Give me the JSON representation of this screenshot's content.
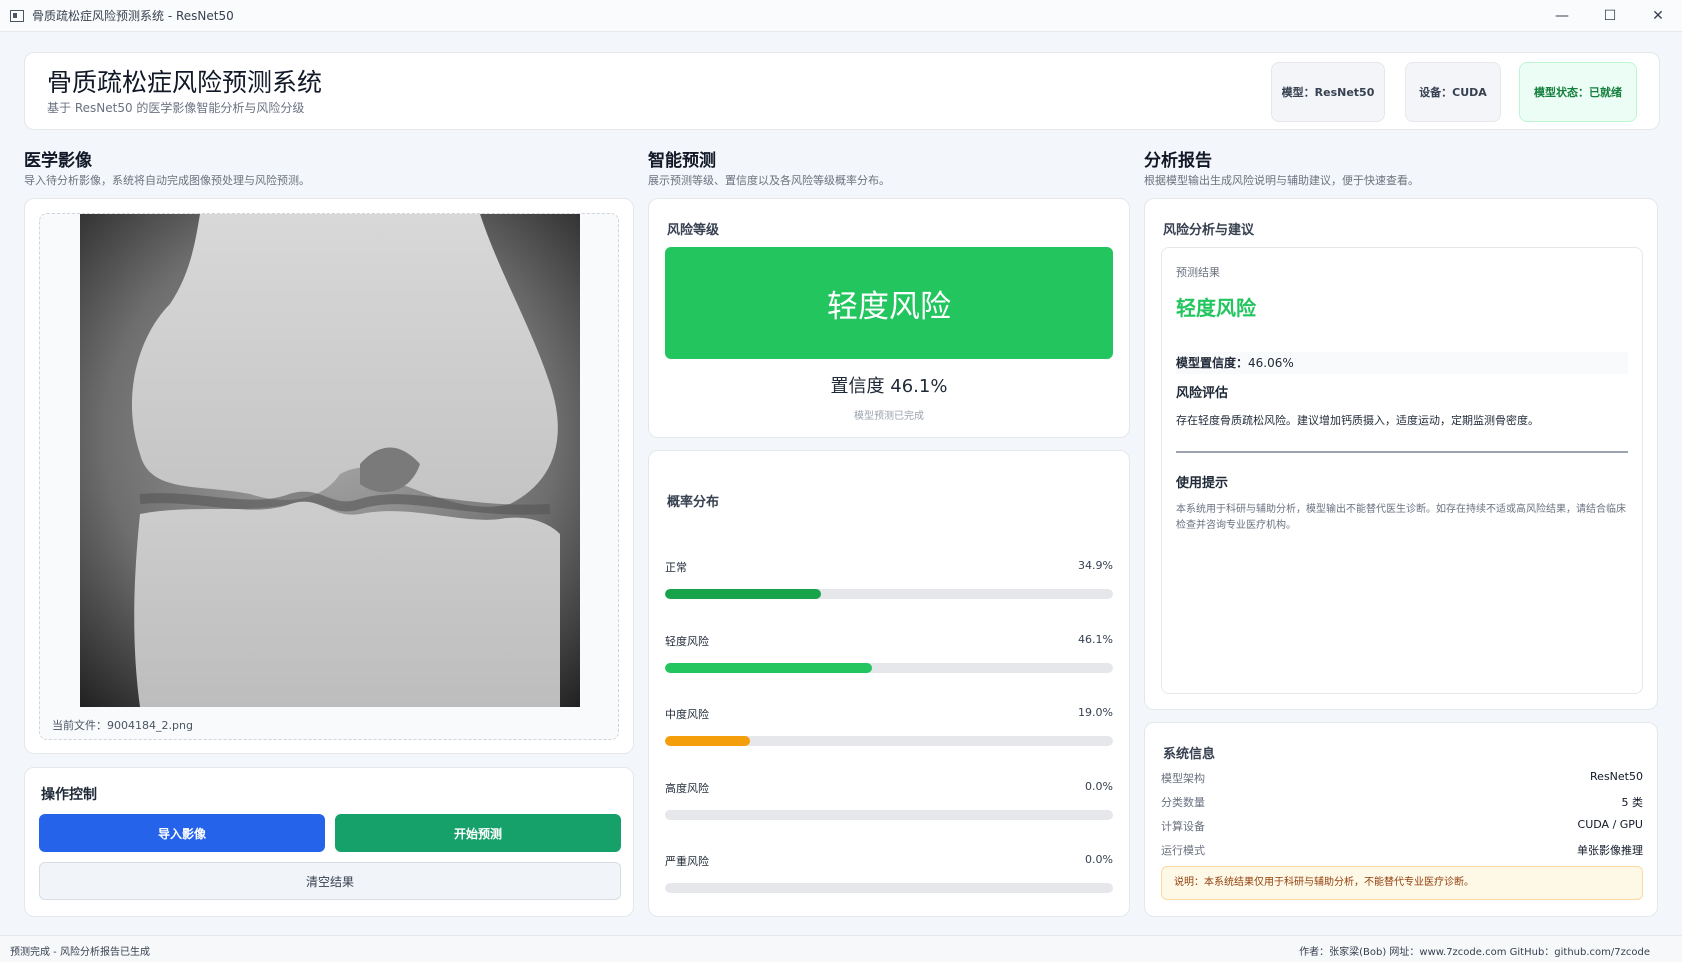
{
  "window": {
    "title": "骨质疏松症风险预测系统 - ResNet50",
    "controls": {
      "minimize": "—",
      "maximize": "☐",
      "close": "✕"
    }
  },
  "header": {
    "title": "骨质疏松症风险预测系统",
    "subtitle": "基于 ResNet50 的医学影像智能分析与风险分级",
    "badges": {
      "model": "模型：ResNet50",
      "device": "设备：CUDA",
      "status": "模型状态：已就绪"
    }
  },
  "sections": {
    "image": {
      "title": "医学影像",
      "subtitle": "导入待分析影像，系统将自动完成图像预处理与风险预测。"
    },
    "predict": {
      "title": "智能预测",
      "subtitle": "展示预测等级、置信度以及各风险等级概率分布。"
    },
    "report": {
      "title": "分析报告",
      "subtitle": "根据模型输出生成风险说明与辅助建议，便于快速查看。"
    }
  },
  "image_panel": {
    "current_file": "当前文件：9004184_2.png"
  },
  "controls": {
    "title": "操作控制",
    "import_label": "导入影像",
    "predict_label": "开始预测",
    "clear_label": "清空结果"
  },
  "risk_card": {
    "title": "风险等级",
    "level": "轻度风险",
    "confidence": "置信度   46.1%",
    "note": "模型预测已完成",
    "color": "#22c55e"
  },
  "probability": {
    "title": "概率分布",
    "items": [
      {
        "label": "正常",
        "value": "34.9%",
        "fraction": 0.349,
        "color": "#16a34a"
      },
      {
        "label": "轻度风险",
        "value": "46.1%",
        "fraction": 0.461,
        "color": "#22c55e"
      },
      {
        "label": "中度风险",
        "value": "19.0%",
        "fraction": 0.19,
        "color": "#f59e0b"
      },
      {
        "label": "高度风险",
        "value": "0.0%",
        "fraction": 0.0,
        "color": "#ef4444"
      },
      {
        "label": "严重风险",
        "value": "0.0%",
        "fraction": 0.0,
        "color": "#b91c1c"
      }
    ]
  },
  "report": {
    "title": "风险分析与建议",
    "result_label": "预测结果",
    "result_value": "轻度风险",
    "confidence_label": "模型置信度：",
    "confidence_value": "46.06%",
    "assessment_title": "风险评估",
    "assessment_text": "存在轻度骨质疏松风险。建议增加钙质摄入，适度运动，定期监测骨密度。",
    "tips_title": "使用提示",
    "tips_text": "本系统用于科研与辅助分析，模型输出不能替代医生诊断。如存在持续不适或高风险结果，请结合临床检查并咨询专业医疗机构。"
  },
  "system_info": {
    "title": "系统信息",
    "rows": [
      {
        "key": "模型架构",
        "value": "ResNet50"
      },
      {
        "key": "分类数量",
        "value": "5 类"
      },
      {
        "key": "计算设备",
        "value": "CUDA / GPU"
      },
      {
        "key": "运行模式",
        "value": "单张影像推理"
      }
    ],
    "note": "说明：本系统结果仅用于科研与辅助分析，不能替代专业医疗诊断。"
  },
  "statusbar": {
    "left": "预测完成 - 风险分析报告已生成",
    "right": "作者：张家梁(Bob)  网址：www.7zcode.com GitHub：github.com/7zcode"
  }
}
